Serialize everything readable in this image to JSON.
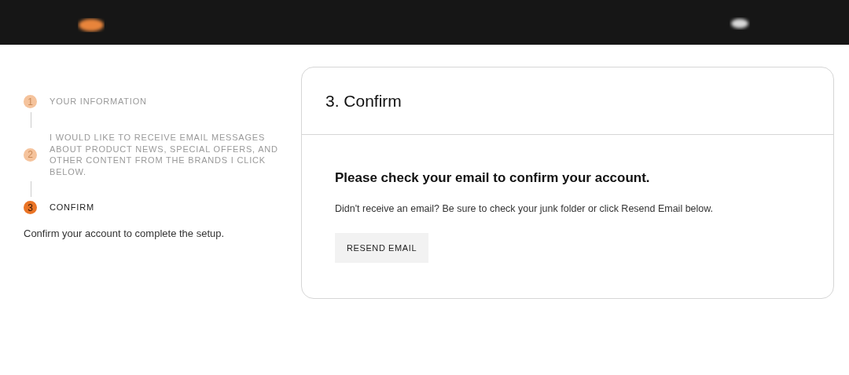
{
  "steps": [
    {
      "number": "1",
      "label": "YOUR INFORMATION",
      "selected": false
    },
    {
      "number": "2",
      "label": "I WOULD LIKE TO RECEIVE EMAIL MESSAGES ABOUT PRODUCT NEWS, SPECIAL OFFERS, AND OTHER CONTENT FROM THE BRANDS I CLICK BELOW.",
      "selected": false
    },
    {
      "number": "3",
      "label": "CONFIRM",
      "selected": true
    }
  ],
  "step_note": "Confirm your account to complete the setup.",
  "card": {
    "title": "3. Confirm",
    "heading": "Please check your email to confirm your account.",
    "message": "Didn't receive an email? Be sure to check your junk folder or click Resend Email below.",
    "button": "RESEND EMAIL"
  }
}
